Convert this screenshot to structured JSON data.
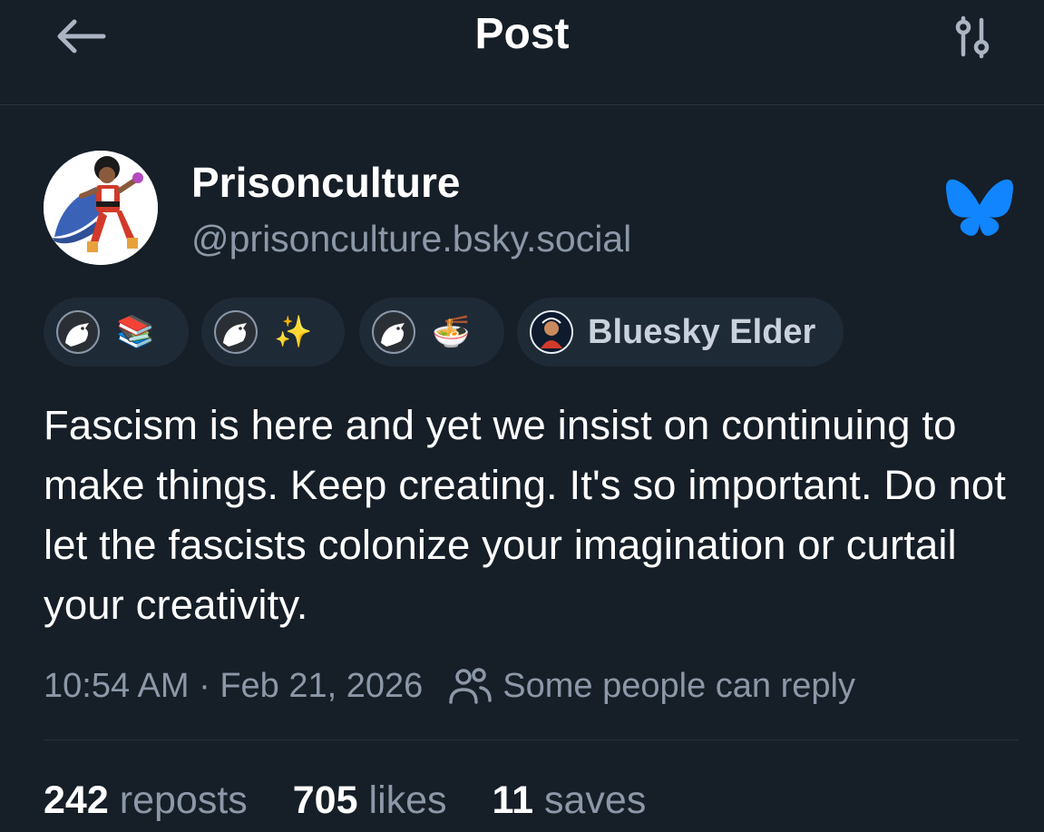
{
  "header": {
    "title": "Post",
    "back_icon": "arrow-left-icon",
    "filter_icon": "sliders-icon"
  },
  "author": {
    "display_name": "Prisonculture",
    "handle": "@prisonculture.bsky.social",
    "platform_icon": "bluesky-butterfly-icon",
    "brand_color": "#1185fe"
  },
  "badges": [
    {
      "icon": "crow-icon",
      "emoji": "📚"
    },
    {
      "icon": "crow-icon",
      "emoji": "✨"
    },
    {
      "icon": "crow-icon",
      "emoji": "🍜"
    },
    {
      "icon": "bluesky-elder-icon",
      "label": "Bluesky Elder"
    }
  ],
  "post": {
    "text": "Fascism is here and yet we insist on continuing to make things. Keep creating. It's so important. Do not let the fascists colonize your imagination or curtail your creativity.",
    "timestamp": "10:54 AM · Feb 21, 2026",
    "reply_setting": "Some people can reply"
  },
  "stats": {
    "reposts": {
      "count": "242",
      "label": "reposts"
    },
    "likes": {
      "count": "705",
      "label": "likes"
    },
    "saves": {
      "count": "11",
      "label": "saves"
    }
  },
  "colors": {
    "background": "#161e27",
    "muted_text": "#8c98a8",
    "badge_bg": "#1f2a37"
  }
}
